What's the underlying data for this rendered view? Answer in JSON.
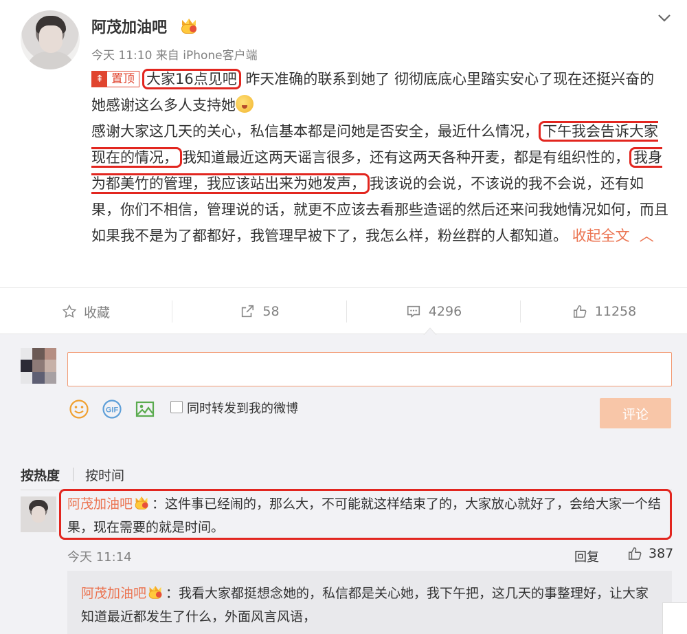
{
  "post": {
    "username": "阿茂加油吧",
    "timestamp": "今天 11:10",
    "source": "来自 iPhone客户端",
    "pin_label": "置顶",
    "highlight_1": "大家16点见吧",
    "line1_rest": "昨天准确的联系到她了 彻彻底底心里踏实安心了现在还挺兴奋的 她感谢这么多人支持她",
    "para2_a": "感谢大家这几天的关心，私信基本都是问她是否安全，最近什么情况，",
    "highlight_2": "下午我会告诉大家现在的情况，",
    "para2_b": "我知道最近这两天谣言很多，还有这两天各种开麦，都是有组织性的，",
    "highlight_3": "我身为都美竹的管理，我应该站出来为她发声，",
    "para2_c": "我该说的会说，不该说的我不会说，还有如果，你们不相信，管理说的话，就更不应该去看那些造谣的然后还来问我她情况如何，而且如果我不是为了都都好，我管理早被下了，我怎么样，粉丝群的人都知道。",
    "collapse_link": "收起全文"
  },
  "actions": {
    "favorite_label": "收藏",
    "repost_count": "58",
    "comment_count": "4296",
    "like_count": "11258"
  },
  "composer": {
    "input_placeholder": "",
    "repost_checkbox_label": "同时转发到我的微博",
    "submit_label": "评论"
  },
  "sort": {
    "hot_label": "按热度",
    "time_label": "按时间"
  },
  "comment": {
    "username": "阿茂加油吧",
    "text": "：这件事已经闹的，那么大，不可能就这样结束了的，大家放心就好了，会给大家一个结果，现在需要的就是时间。",
    "time": "今天 11:14",
    "reply_label": "回复",
    "like_count": "387"
  },
  "sub_comment": {
    "username": "阿茂加油吧",
    "text": "：我看大家都挺想念她的，私信都是关心她，我下午把，这几天的事整理好，让大家知道最近都发生了什么，外面风言风语，"
  },
  "colors": {
    "accent_orange": "#eb7350",
    "highlight_red": "#e2261f",
    "submit_bg": "#f8c6a8"
  },
  "icons": [
    "chevron-down-icon",
    "pin-icon",
    "star-icon",
    "repost-icon",
    "comment-icon",
    "like-icon",
    "smiley-icon",
    "gif-icon",
    "image-icon",
    "vip-crown-icon"
  ]
}
